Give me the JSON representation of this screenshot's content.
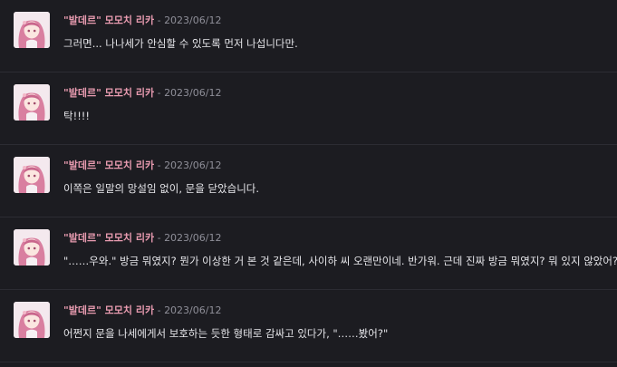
{
  "messages": [
    {
      "author": "\"발데르\" 모모치 리카",
      "separator": " - ",
      "date": "2023/06/12",
      "text": "그러면... 나나세가 안심할 수 있도록 먼저 나섭니다만."
    },
    {
      "author": "\"발데르\" 모모치 리카",
      "separator": " - ",
      "date": "2023/06/12",
      "text": "탁!!!!"
    },
    {
      "author": "\"발데르\" 모모치 리카",
      "separator": " - ",
      "date": "2023/06/12",
      "text": "이쪽은 일말의 망설임 없이, 문을 닫았습니다."
    },
    {
      "author": "\"발데르\" 모모치 리카",
      "separator": " - ",
      "date": "2023/06/12",
      "text": "\"……우와.\" 방금 뭐였지? 뭔가 이상한 거 본 것 같은데, 사이하 씨 오랜만이네. 반가워. 근데 진짜 방금 뭐였지? 뭐 있지 않았어?"
    },
    {
      "author": "\"발데르\" 모모치 리카",
      "separator": " - ",
      "date": "2023/06/12",
      "text": "어쩐지 문을 나세에게서 보호하는 듯한 형태로 감싸고 있다가, \"……봤어?\""
    }
  ],
  "avatar_icon": "anime-girl-avatar-icon",
  "colors": {
    "background": "#1c1c21",
    "author": "#e89bb0",
    "date": "#8f8f99",
    "text": "#e6e6ea",
    "divider": "#2c2c33"
  }
}
